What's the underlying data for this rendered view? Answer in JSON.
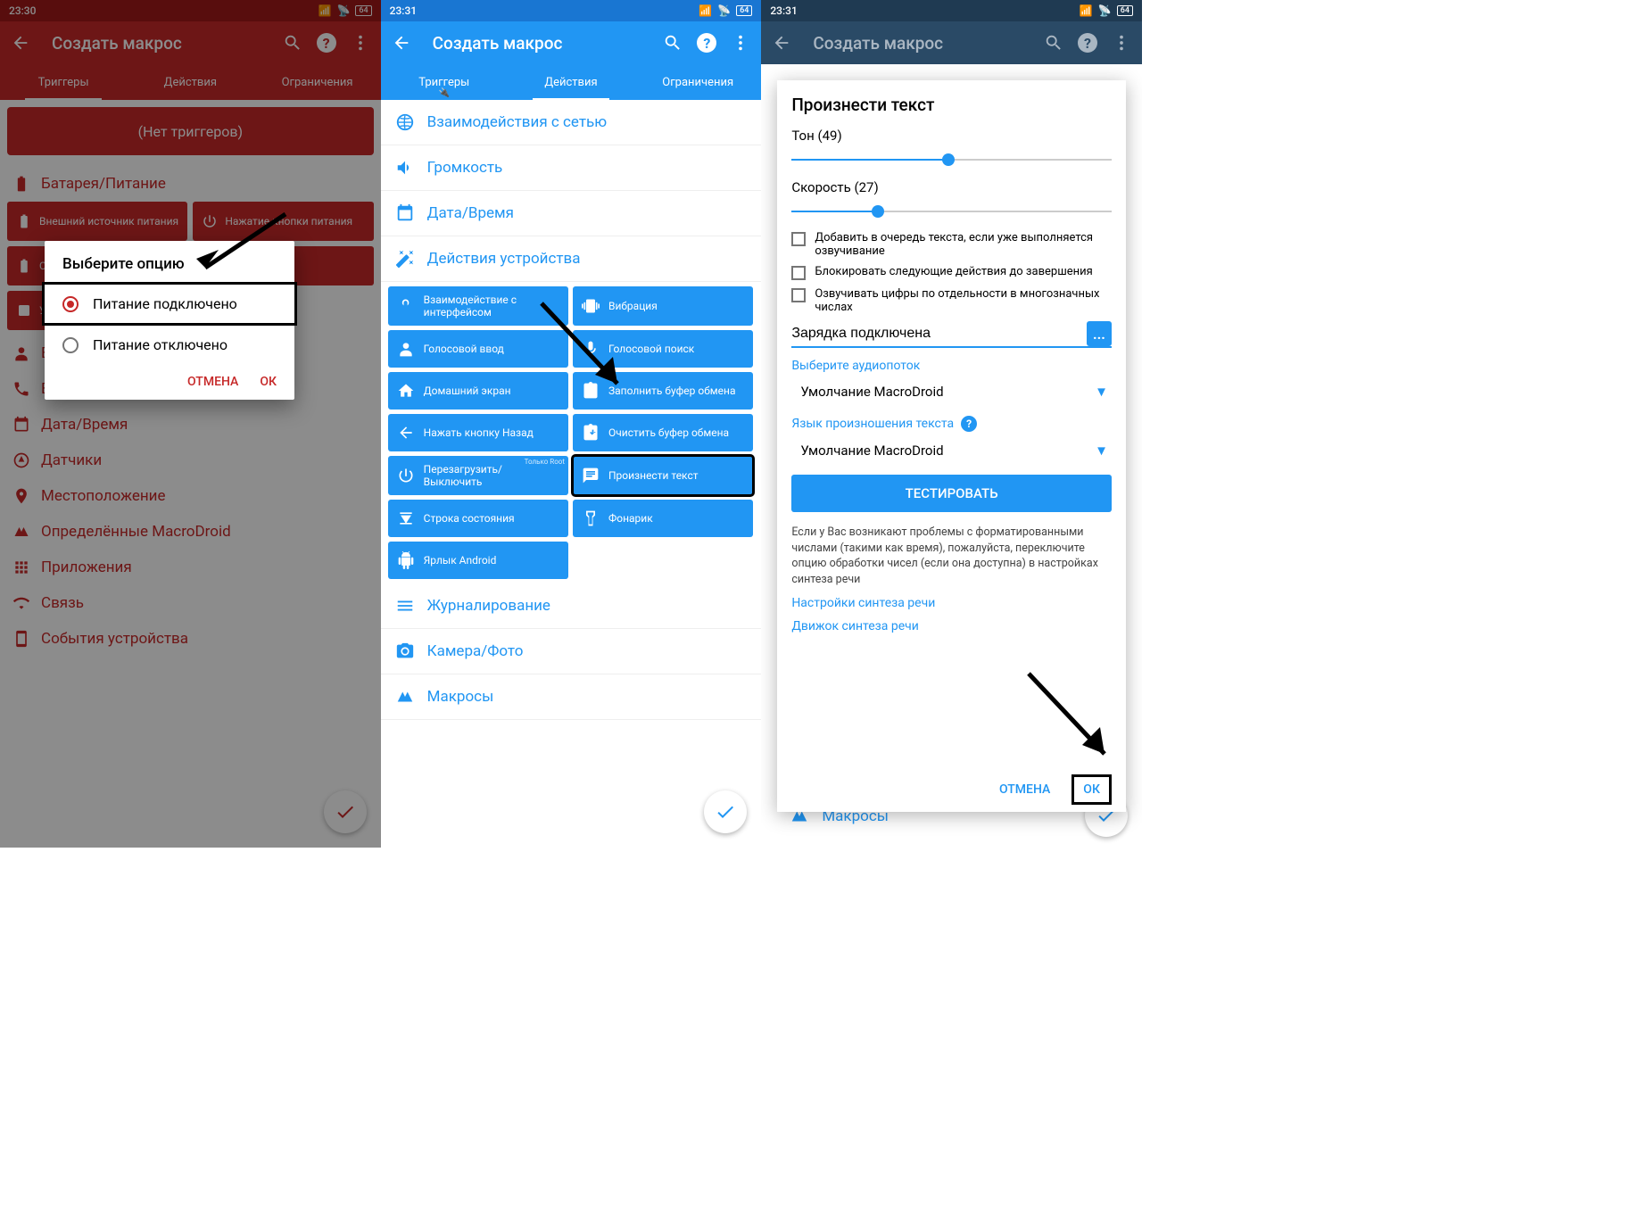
{
  "status": {
    "time1": "23:30",
    "time2": "23:31",
    "time3": "23:31",
    "battery": "64"
  },
  "appbar": {
    "title": "Создать макрос"
  },
  "tabs": {
    "triggers": "Триггеры",
    "actions": "Действия",
    "constraints": "Ограничения"
  },
  "p1": {
    "no_triggers": "(Нет триггеров)",
    "cat_battery": "Батарея/Питание",
    "tile_ext_power": "Внешний источник питания",
    "tile_button_press": "Нажатие кнопки питания",
    "tile_state": "Состояние питания",
    "cat_datetime": "Дата/Время",
    "cat_sensors": "Датчики",
    "cat_location": "Местоположение",
    "cat_macrodroid": "Определённые MacroDroid",
    "cat_apps": "Приложения",
    "cat_conn": "Связь",
    "cat_device_events": "События устройства"
  },
  "dialog1": {
    "title": "Выберите опцию",
    "opt1": "Питание подключено",
    "opt2": "Питание отключено",
    "cancel": "ОТМЕНА",
    "ok": "ОК"
  },
  "p2": {
    "cat_network": "Взаимодействия с сетью",
    "cat_volume": "Громкость",
    "cat_datetime": "Дата/Время",
    "cat_device_actions": "Действия устройства",
    "t_ui_interact": "Взаимодействие с интерфейсом",
    "t_vibration": "Вибрация",
    "t_voice_input": "Голосовой ввод",
    "t_voice_search": "Голосовой поиск",
    "t_home": "Домашний экран",
    "t_fill_clip": "Заполнить буфер обмена",
    "t_back": "Нажать кнопку Назад",
    "t_clear_clip": "Очистить буфер обмена",
    "t_reboot": "Перезагрузить/Выключить",
    "t_root": "Только Root",
    "t_speak": "Произнести текст",
    "t_statusbar": "Строка состояния",
    "t_torch": "Фонарик",
    "t_shortcut": "Ярлык Android",
    "cat_logging": "Журналирование",
    "cat_camera": "Камера/Фото",
    "cat_macros": "Макросы"
  },
  "d3": {
    "title": "Произнести текст",
    "tone_label": "Тон  (49)",
    "tone_pct": 49,
    "speed_label": "Скорость  (27)",
    "speed_pct": 27,
    "chk1": "Добавить в очередь текста, если уже выполняется озвучивание",
    "chk2": "Блокировать следующие действия до завершения",
    "chk3": "Озвучивать цифры по отдельности в многозначных числах",
    "input_value": "Зарядка подключена",
    "audio_label": "Выберите аудиопоток",
    "audio_value": "Умолчание MacroDroid",
    "lang_label": "Язык произношения текста",
    "lang_value": "Умолчание MacroDroid",
    "test": "ТЕСТИРОВАТЬ",
    "help": "Если у Вас возникают проблемы с форматированными числами (такими как время), пожалуйста, переключите опцию обработки чисел (если она доступна) в настройках синтеза речи",
    "link1": "Настройки синтеза речи",
    "link2": "Движок синтеза речи",
    "cancel": "ОТМЕНА",
    "ok": "ОК",
    "macros": "Макросы"
  }
}
